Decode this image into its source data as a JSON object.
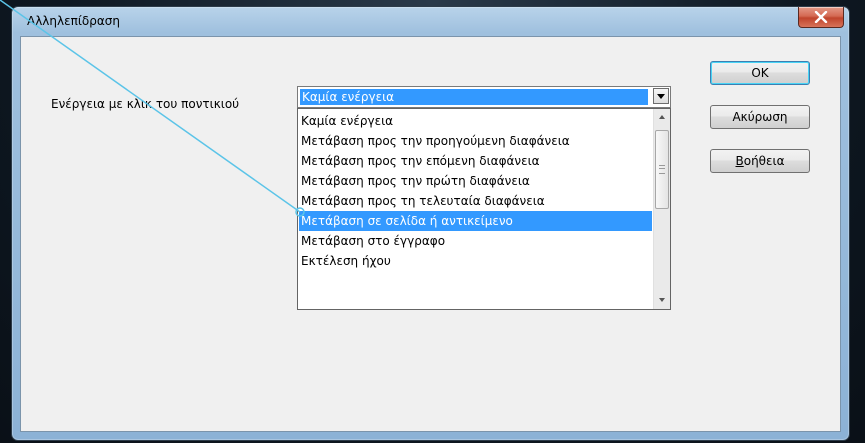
{
  "window": {
    "title": "Αλληλεπίδραση"
  },
  "form": {
    "action_label": "Ενέργεια με κλικ του ποντικιού",
    "selected_action": "Καμία ενέργεια"
  },
  "dropdown": {
    "items": [
      "Καμία ενέργεια",
      "Μετάβαση προς την προηγούμενη διαφάνεια",
      "Μετάβαση προς την επόμενη διαφάνεια",
      "Μετάβαση προς την πρώτη διαφάνεια",
      "Μετάβαση προς τη τελευταία διαφάνεια",
      "Μετάβαση σε σελίδα ή αντικείμενο",
      "Μετάβαση στο έγγραφο",
      "Εκτέλεση ήχου"
    ],
    "highlighted_index": 5
  },
  "buttons": {
    "ok": "OK",
    "cancel": "Ακύρωση",
    "help": "Βοήθεια"
  },
  "colors": {
    "selection": "#3399ff",
    "connector_line": "#5bc4e8"
  }
}
